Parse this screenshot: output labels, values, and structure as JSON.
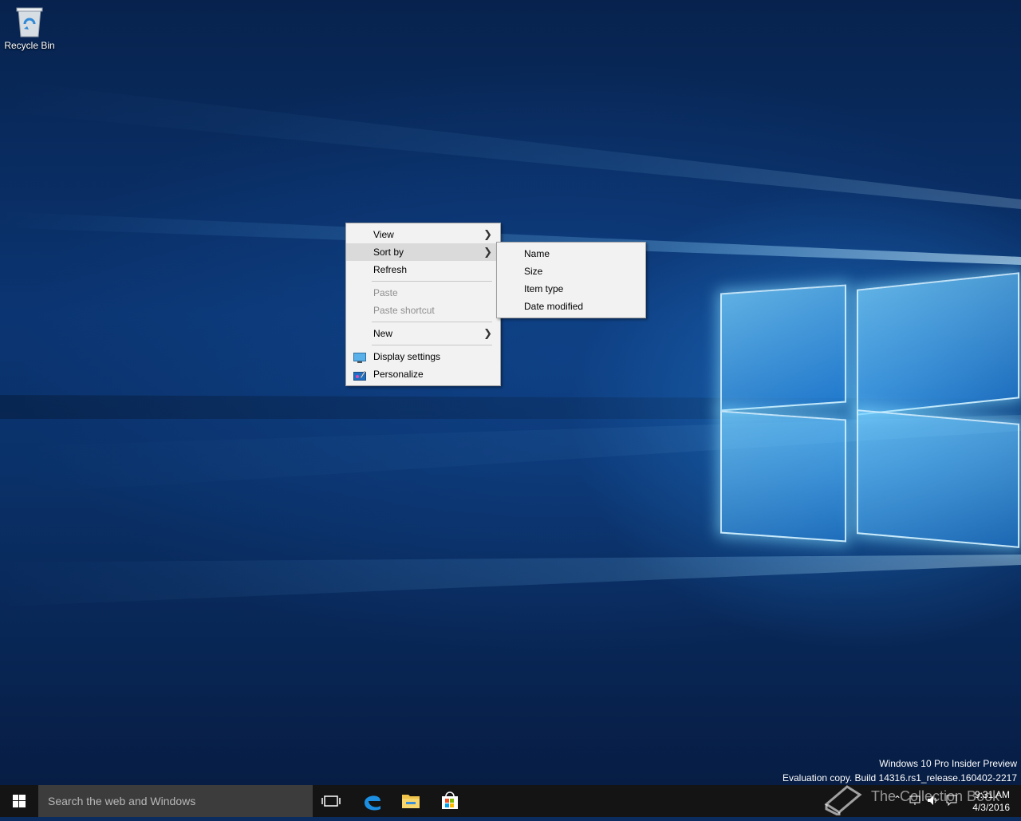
{
  "desktop": {
    "icons": [
      {
        "label": "Recycle Bin"
      }
    ]
  },
  "context_menu": {
    "items": [
      {
        "label": "View",
        "has_submenu": true
      },
      {
        "label": "Sort by",
        "has_submenu": true,
        "highlighted": true
      },
      {
        "label": "Refresh"
      },
      {
        "label": "Paste",
        "disabled": true
      },
      {
        "label": "Paste shortcut",
        "disabled": true
      },
      {
        "label": "New",
        "has_submenu": true
      },
      {
        "label": "Display settings",
        "icon": "display-settings-icon"
      },
      {
        "label": "Personalize",
        "icon": "personalize-icon"
      }
    ]
  },
  "sort_submenu": {
    "items": [
      {
        "label": "Name"
      },
      {
        "label": "Size"
      },
      {
        "label": "Item type"
      },
      {
        "label": "Date modified"
      }
    ]
  },
  "watermark": {
    "line1": "Windows 10 Pro Insider Preview",
    "line2": "Evaluation copy. Build 14316.rs1_release.160402-2217"
  },
  "taskbar": {
    "search_placeholder": "Search the web and Windows",
    "pinned": [
      "task-view-icon",
      "edge-icon",
      "file-explorer-icon",
      "store-icon"
    ],
    "clock_time": "9:31 AM",
    "clock_date": "4/3/2016"
  },
  "overlay": {
    "brand_text": "The Collection Book"
  }
}
